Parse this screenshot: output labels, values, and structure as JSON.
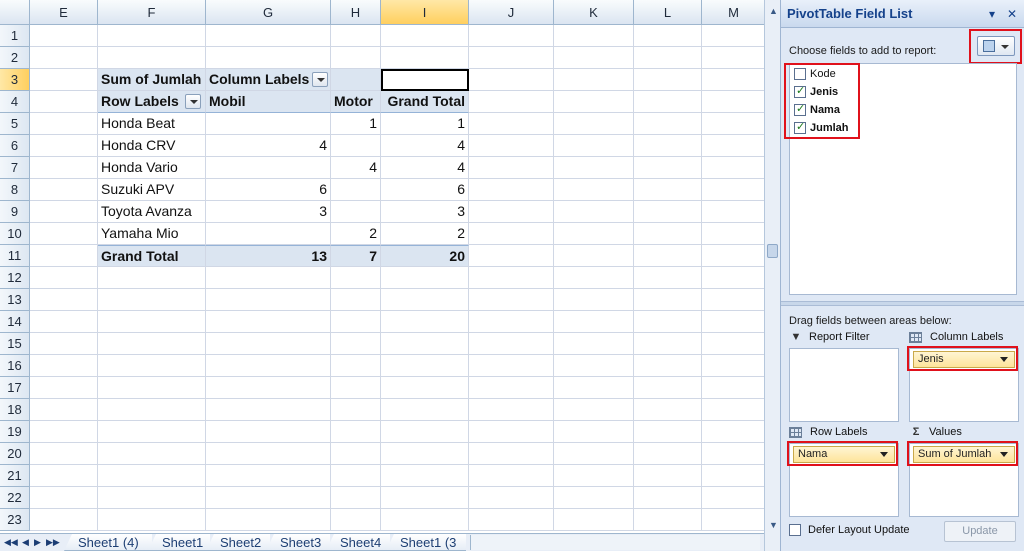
{
  "columns": [
    "E",
    "F",
    "G",
    "H",
    "I",
    "J",
    "K",
    "L",
    "M"
  ],
  "selected_column": "I",
  "rows": [
    "1",
    "2",
    "3",
    "4",
    "5",
    "6",
    "7",
    "8",
    "9",
    "10",
    "11",
    "12",
    "13",
    "14",
    "15",
    "16",
    "17",
    "18",
    "19",
    "20",
    "21",
    "22",
    "23"
  ],
  "selected_row": "3",
  "pivot": {
    "value_header": "Sum of Jumlah",
    "column_labels": "Column Labels",
    "row_labels": "Row Labels",
    "col_mobil": "Mobil",
    "col_motor": "Motor",
    "col_grand_total": "Grand Total",
    "data": [
      {
        "label": "Honda Beat",
        "mobil": "",
        "motor": "1",
        "total": "1"
      },
      {
        "label": "Honda CRV",
        "mobil": "4",
        "motor": "",
        "total": "4"
      },
      {
        "label": "Honda Vario",
        "mobil": "",
        "motor": "4",
        "total": "4"
      },
      {
        "label": "Suzuki APV",
        "mobil": "6",
        "motor": "",
        "total": "6"
      },
      {
        "label": "Toyota Avanza",
        "mobil": "3",
        "motor": "",
        "total": "3"
      },
      {
        "label": "Yamaha Mio",
        "mobil": "",
        "motor": "2",
        "total": "2"
      }
    ],
    "grand_total_label": "Grand Total",
    "grand_mobil": "13",
    "grand_motor": "7",
    "grand_total": "20"
  },
  "sheet_tabs": [
    "Sheet1 (4)",
    "Sheet1",
    "Sheet2",
    "Sheet3",
    "Sheet4",
    "Sheet1 (3"
  ],
  "pane": {
    "title": "PivotTable Field List",
    "choose_label": "Choose fields to add to report:",
    "fields": [
      {
        "name": "Kode",
        "checked": false
      },
      {
        "name": "Jenis",
        "checked": true
      },
      {
        "name": "Nama",
        "checked": true
      },
      {
        "name": "Jumlah",
        "checked": true
      }
    ],
    "drag_label": "Drag fields between areas below:",
    "report_filter": "Report Filter",
    "column_labels": "Column Labels",
    "row_labels": "Row Labels",
    "values": "Values",
    "column_field": "Jenis",
    "row_field": "Nama",
    "value_field": "Sum of Jumlah",
    "defer_label": "Defer Layout Update",
    "update_label": "Update"
  },
  "colors": {
    "highlight_red": "#e0111b",
    "pivot_header_bg": "#dbe5f1",
    "chip_bg": "#fde49a"
  }
}
